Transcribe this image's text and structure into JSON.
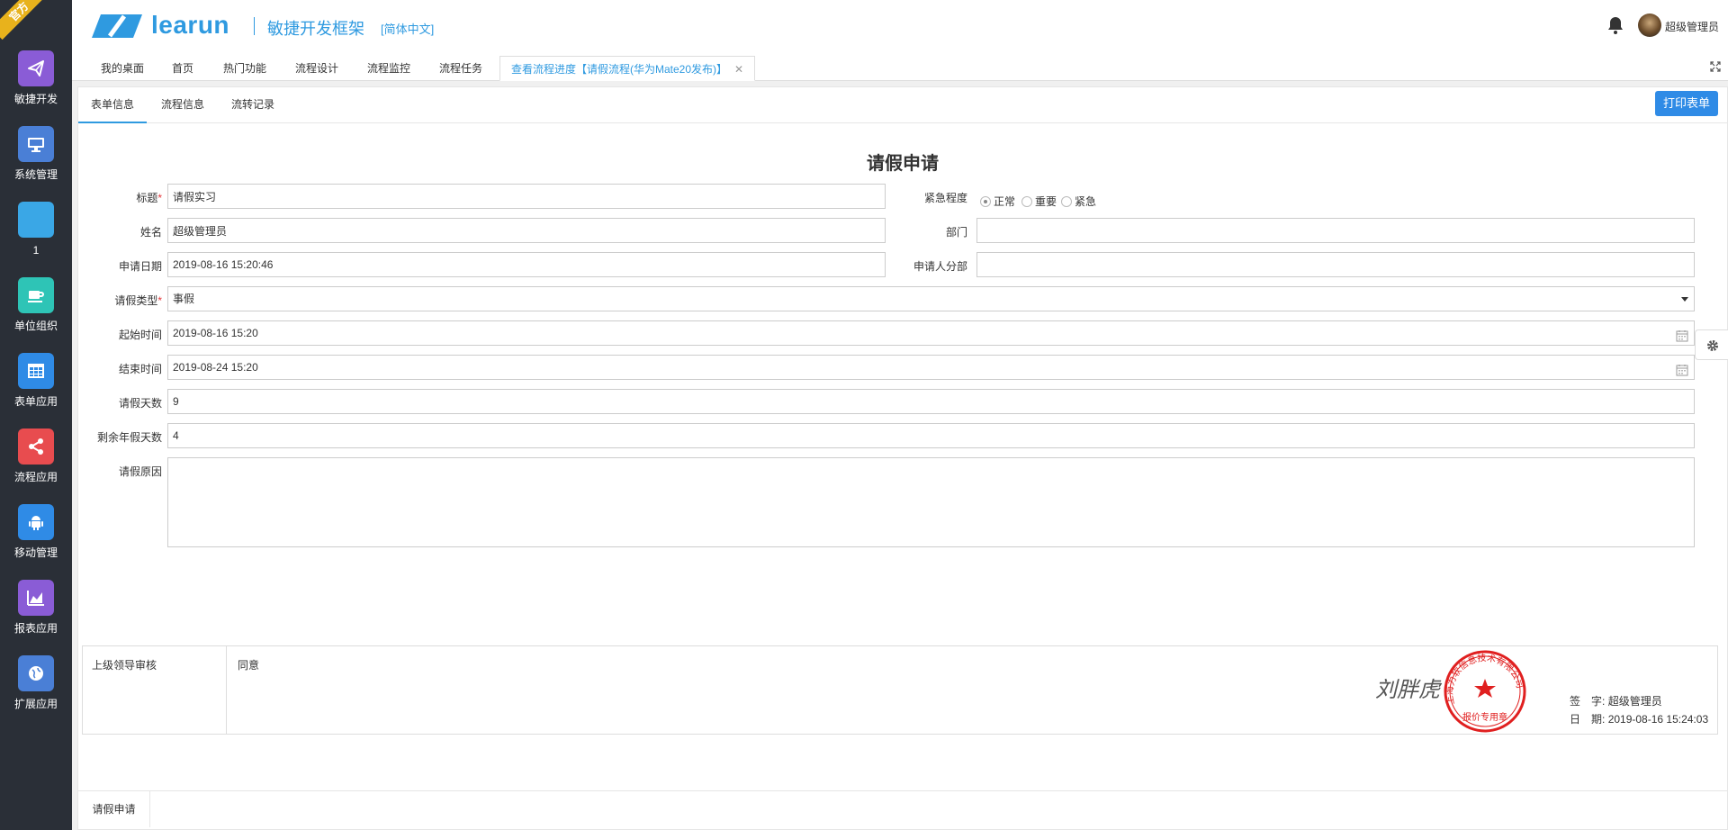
{
  "ribbon": "官方",
  "app": {
    "logo_text": "learun",
    "subtitle": "敏捷开发框架",
    "lang": "[简体中文]",
    "user_name": "超级管理员"
  },
  "sidebar": {
    "items": [
      {
        "label": "敏捷开发",
        "icon": "paper-plane-icon",
        "color": "#8a5cd6"
      },
      {
        "label": "系统管理",
        "icon": "monitor-icon",
        "color": "#4a7fd6"
      },
      {
        "label": "1",
        "icon": "blank-icon",
        "color": "#3aa7e6"
      },
      {
        "label": "单位组织",
        "icon": "coffee-icon",
        "color": "#2ec4b6"
      },
      {
        "label": "表单应用",
        "icon": "grid-icon",
        "color": "#2f8be6"
      },
      {
        "label": "流程应用",
        "icon": "share-icon",
        "color": "#e84c4f"
      },
      {
        "label": "移动管理",
        "icon": "android-icon",
        "color": "#2f8be6"
      },
      {
        "label": "报表应用",
        "icon": "area-chart-icon",
        "color": "#8a5cd6"
      },
      {
        "label": "扩展应用",
        "icon": "globe-icon",
        "color": "#4a7fd6"
      }
    ]
  },
  "tabs": [
    {
      "label": "我的桌面"
    },
    {
      "label": "首页"
    },
    {
      "label": "热门功能"
    },
    {
      "label": "流程设计"
    },
    {
      "label": "流程监控"
    },
    {
      "label": "流程任务"
    },
    {
      "label": "查看流程进度【请假流程(华为Mate20发布)】",
      "active": true
    }
  ],
  "subtabs": [
    {
      "label": "表单信息",
      "active": true
    },
    {
      "label": "流程信息"
    },
    {
      "label": "流转记录"
    }
  ],
  "print_label": "打印表单",
  "form": {
    "title": "请假申请",
    "fields": {
      "title_label": "标题",
      "title_value": "请假实习",
      "urgency_label": "紧急程度",
      "urgency_options": [
        "正常",
        "重要",
        "紧急"
      ],
      "urgency_selected": "正常",
      "name_label": "姓名",
      "name_value": "超级管理员",
      "dept_label": "部门",
      "dept_value": "",
      "date_label": "申请日期",
      "date_value": "2019-08-16 15:20:46",
      "subdept_label": "申请人分部",
      "subdept_value": "",
      "type_label": "请假类型",
      "type_value": "事假",
      "start_label": "起始时间",
      "start_value": "2019-08-16 15:20",
      "end_label": "结束时间",
      "end_value": "2019-08-24 15:20",
      "days_label": "请假天数",
      "days_value": "9",
      "annual_label": "剩余年假天数",
      "annual_value": "4",
      "reason_label": "请假原因",
      "reason_value": ""
    }
  },
  "approval": {
    "label": "上级领导审核",
    "opinion": "同意",
    "sign_label": "签　字:",
    "sign_value": "超级管理员",
    "date_label": "日　期:",
    "date_value": "2019-08-16 15:24:03",
    "stamp_text": "上海力软信息技术有限公司",
    "stamp_bottom": "报价专用章",
    "signature": "刘胖虎"
  },
  "bottom_tab": "请假申请"
}
